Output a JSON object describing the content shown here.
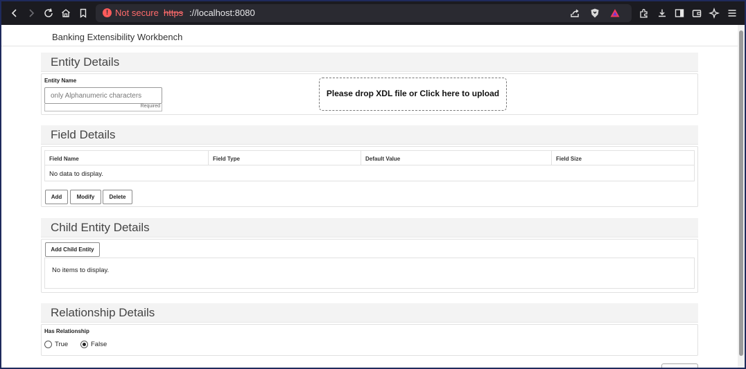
{
  "browser": {
    "security_label": "Not secure",
    "url_scheme": "https",
    "url_rest": "://localhost:8080"
  },
  "app": {
    "title": "Banking Extensibility Workbench"
  },
  "entity": {
    "heading": "Entity Details",
    "name_label": "Entity Name",
    "name_placeholder": "only Alphanumeric characters",
    "name_value": "",
    "required_hint": "Required",
    "upload_text": "Please drop XDL file or Click here to upload"
  },
  "fields": {
    "heading": "Field Details",
    "columns": [
      "Field Name",
      "Field Type",
      "Default Value",
      "Field Size"
    ],
    "empty_text": "No data to display.",
    "buttons": {
      "add": "Add",
      "modify": "Modify",
      "delete": "Delete"
    }
  },
  "child": {
    "heading": "Child Entity Details",
    "add_button": "Add Child Entity",
    "empty_text": "No items to display."
  },
  "relationship": {
    "heading": "Relationship Details",
    "label": "Has Relationship",
    "options": [
      "True",
      "False"
    ],
    "selected": "False"
  }
}
